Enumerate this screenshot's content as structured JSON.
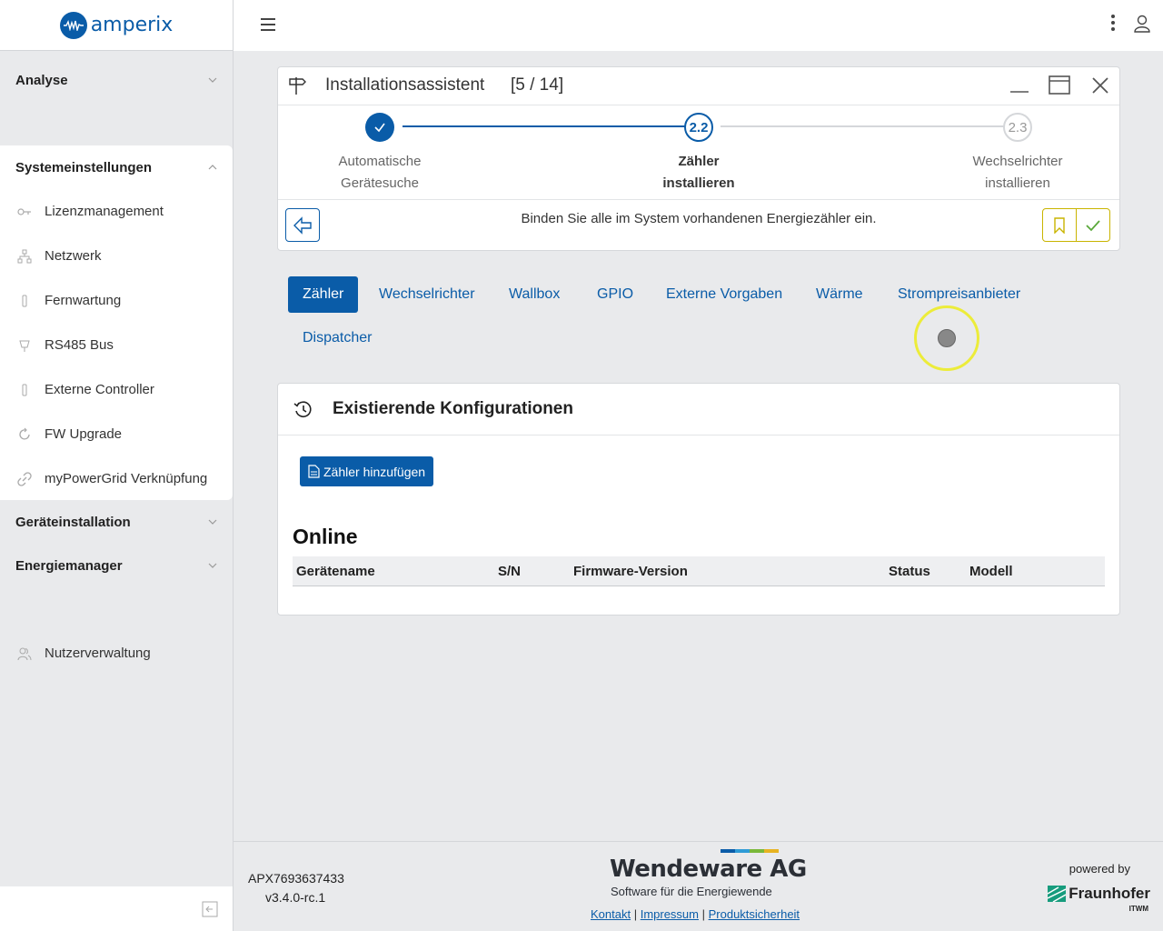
{
  "brand": {
    "name": "amperix"
  },
  "sidebar": {
    "sections": [
      {
        "label": "Analyse"
      },
      {
        "label": "Systemeinstellungen"
      },
      {
        "label": "Geräteinstallation"
      },
      {
        "label": "Energiemanager"
      }
    ],
    "items": [
      {
        "label": "Lizenzmanagement",
        "icon": "key-icon"
      },
      {
        "label": "Netzwerk",
        "icon": "network-icon"
      },
      {
        "label": "Fernwartung",
        "icon": "plug-icon"
      },
      {
        "label": "RS485 Bus",
        "icon": "connector-icon"
      },
      {
        "label": "Externe Controller",
        "icon": "plug-icon"
      },
      {
        "label": "FW Upgrade",
        "icon": "refresh-icon"
      },
      {
        "label": "myPowerGrid Verknüpfung",
        "icon": "link-icon"
      }
    ],
    "user_management": {
      "label": "Nutzerverwaltung",
      "icon": "users-icon"
    }
  },
  "wizard": {
    "title": "Installationsassistent",
    "counter": "[5 / 14]",
    "steps": [
      {
        "number": "",
        "line1": "Automatische",
        "line2": "Gerätesuche",
        "state": "done"
      },
      {
        "number": "2.2",
        "line1": "Zähler",
        "line2": "installieren",
        "state": "active"
      },
      {
        "number": "2.3",
        "line1": "Wechselrichter",
        "line2": "installieren",
        "state": "pending"
      }
    ],
    "message": "Binden Sie alle im System vorhandenen Energiezähler ein."
  },
  "tabs": [
    {
      "label": "Zähler",
      "active": true
    },
    {
      "label": "Wechselrichter"
    },
    {
      "label": "Wallbox"
    },
    {
      "label": "GPIO"
    },
    {
      "label": "Externe Vorgaben"
    },
    {
      "label": "Wärme"
    },
    {
      "label": "Strompreisanbieter"
    },
    {
      "label": "Dispatcher"
    }
  ],
  "config": {
    "title": "Existierende Konfigurationen",
    "add_button": "Zähler hinzufügen",
    "online_title": "Online",
    "columns": [
      "Gerätename",
      "S/N",
      "Firmware-Version",
      "Status",
      "Modell"
    ],
    "rows": []
  },
  "footer": {
    "serial": "APX7693637433",
    "version": "v3.4.0-rc.1",
    "company": "Wendeware AG",
    "tagline": "Software für die Energiewende",
    "links": [
      "Kontakt",
      "Impressum",
      "Produktsicherheit"
    ],
    "powered_by": "powered by",
    "partner": "Fraunhofer",
    "partner_sub": "ITWM"
  },
  "colors": {
    "primary": "#0a5ca8",
    "accent_yellow": "#c9b400",
    "confirm_green": "#5aa83a"
  }
}
